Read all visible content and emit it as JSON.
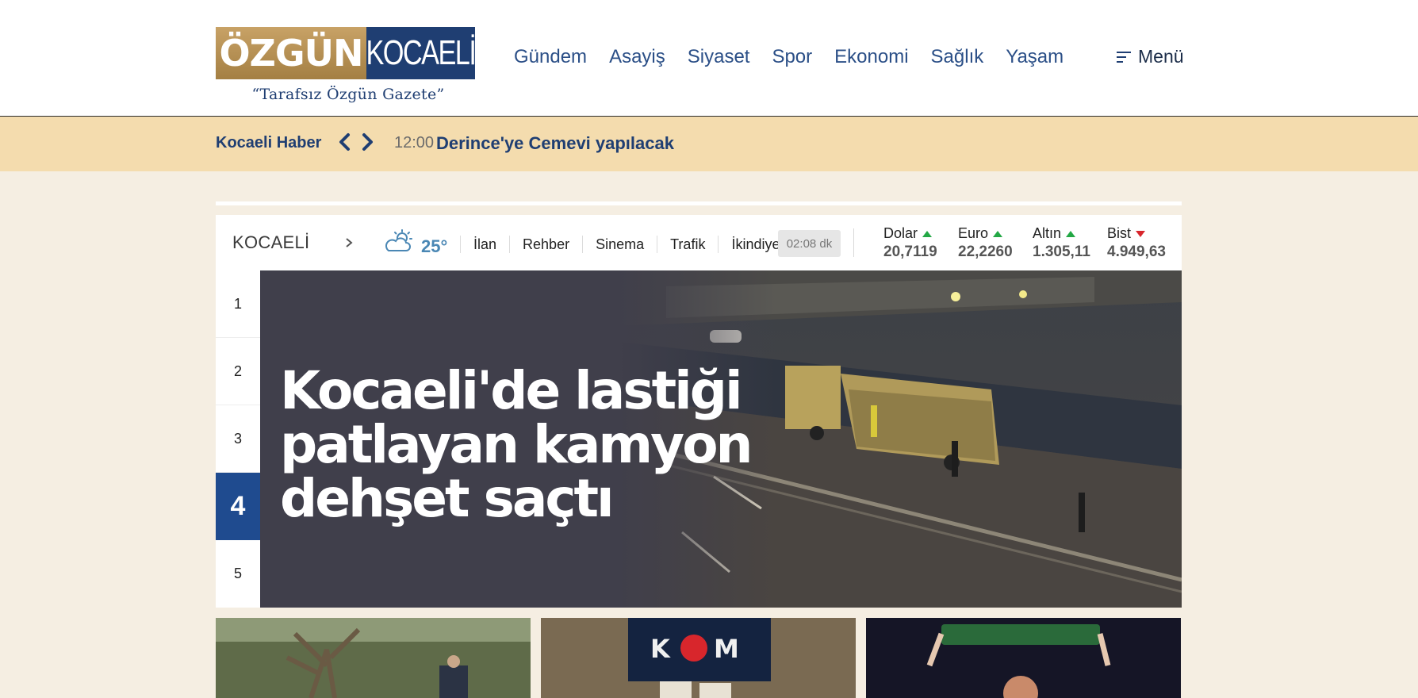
{
  "header": {
    "logo": {
      "left_text": "ÖZGÜN",
      "right_text": "KOCAELİ",
      "tagline": "“Tarafsız Özgün Gazete”"
    },
    "nav": [
      "Gündem",
      "Asayiş",
      "Siyaset",
      "Spor",
      "Ekonomi",
      "Sağlık",
      "Yaşam"
    ],
    "menu_label": "Menü"
  },
  "ticker": {
    "label": "Kocaeli Haber",
    "time": "12:00",
    "headline": "Derince'ye Cemevi yapılacak"
  },
  "infobar": {
    "city": "KOCAELİ",
    "temperature": "25°",
    "links": [
      "İlan",
      "Rehber",
      "Sinema",
      "Trafik",
      "İkindiye"
    ],
    "prayer_countdown": "02:08 dk",
    "markets": [
      {
        "name": "Dolar",
        "value": "20,7119",
        "trend": "up"
      },
      {
        "name": "Euro",
        "value": "22,2260",
        "trend": "up"
      },
      {
        "name": "Altın",
        "value": "1.305,11",
        "trend": "up"
      },
      {
        "name": "Bist",
        "value": "4.949,63",
        "trend": "down"
      }
    ],
    "colors": {
      "up": "#23a845",
      "down": "#d8262c"
    }
  },
  "slider": {
    "numbers": [
      "1",
      "2",
      "3",
      "4",
      "5"
    ],
    "active_index": 3,
    "headline": "Kocaeli'de lastiği patlayan kamyon dehşet saçtı"
  },
  "colors": {
    "brand_blue": "#1f3e72",
    "brand_gold": "#b48f52",
    "ticker_bg": "#f4dcae",
    "page_bg": "#f5eee2"
  }
}
